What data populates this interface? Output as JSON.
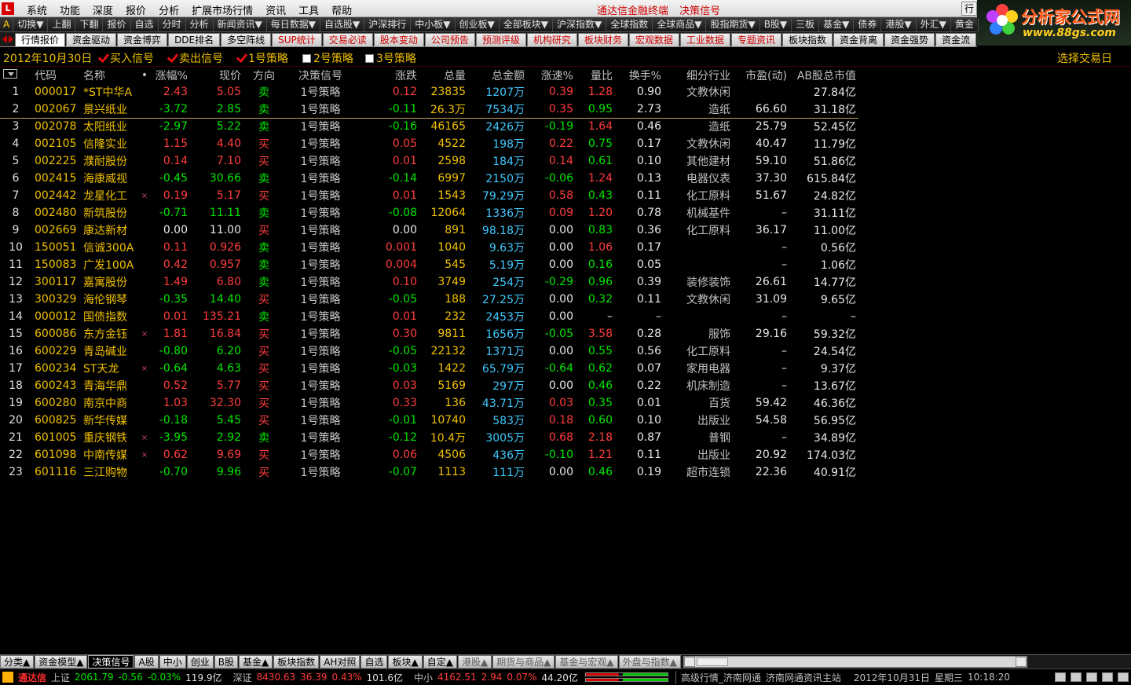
{
  "titlebar": {
    "app_icon": "tdx-logo-icon",
    "menus": [
      "系统",
      "功能",
      "深度",
      "报价",
      "分析",
      "扩展市场行情",
      "资讯",
      "工具",
      "帮助"
    ],
    "center_text": [
      "通达信金融终端",
      "决策信号"
    ],
    "right_button": "行"
  },
  "brand": {
    "title": "分析家公式网",
    "url": "www.88gs.com"
  },
  "toolbar": {
    "items": [
      "A",
      "切换▼",
      "上翻",
      "下翻",
      "报价",
      "自选",
      "分时",
      "分析",
      "新闻资讯▼",
      "每日数据▼",
      "自选股▼",
      "沪深排行",
      "中小板▼",
      "创业板▼",
      "全部板块▼",
      "沪深指数▼",
      "全球指数",
      "全球商品▼",
      "股指期货▼",
      "B股▼",
      "三板",
      "基金▼",
      "债券",
      "港股▼",
      "外汇▼",
      "黄金"
    ]
  },
  "tabs": [
    {
      "label": "行情报价",
      "red": false,
      "active": true
    },
    {
      "label": "资金驱动",
      "red": false,
      "active": false
    },
    {
      "label": "资金博弈",
      "red": false,
      "active": false
    },
    {
      "label": "DDE排名",
      "red": false,
      "active": false
    },
    {
      "label": "多空阵线",
      "red": false,
      "active": false
    },
    {
      "label": "SUP统计",
      "red": true,
      "active": false
    },
    {
      "label": "交易必读",
      "red": true,
      "active": false
    },
    {
      "label": "股本变动",
      "red": true,
      "active": false
    },
    {
      "label": "公司预告",
      "red": true,
      "active": false
    },
    {
      "label": "预测评级",
      "red": true,
      "active": false
    },
    {
      "label": "机构研究",
      "red": true,
      "active": false
    },
    {
      "label": "板块财务",
      "red": true,
      "active": false
    },
    {
      "label": "宏观数据",
      "red": true,
      "active": false
    },
    {
      "label": "工业数据",
      "red": true,
      "active": false
    },
    {
      "label": "专题资讯",
      "red": true,
      "active": false
    },
    {
      "label": "板块指数",
      "red": false,
      "active": false
    },
    {
      "label": "资金背离",
      "red": false,
      "active": false
    },
    {
      "label": "资金强势",
      "red": false,
      "active": false
    },
    {
      "label": "资金流",
      "red": false,
      "active": false
    }
  ],
  "inforow": {
    "date": "2012年10月30日",
    "options": [
      {
        "label": "买入信号",
        "checked": true
      },
      {
        "label": "卖出信号",
        "checked": true
      },
      {
        "label": "1号策略",
        "checked": true
      },
      {
        "label": "2号策略",
        "checked": false
      },
      {
        "label": "3号策略",
        "checked": false
      }
    ],
    "select_date": "选择交易日"
  },
  "table": {
    "headers": [
      "代码",
      "名称",
      "•",
      "涨幅%",
      "现价",
      "方向",
      "决策信号",
      "涨跌",
      "总量",
      "总金额",
      "涨速%",
      "量比",
      "换手%",
      "细分行业",
      "市盈(动)",
      "AB股总市值"
    ],
    "rows": [
      {
        "no": "1",
        "code": "000017",
        "name": "*ST中华A",
        "mark": "",
        "chg": "2.43",
        "price": "5.05",
        "dir": "卖",
        "signal": "1号策略",
        "diff": "0.12",
        "vol": "23835",
        "amt": "1207万",
        "speed": "0.39",
        "qr": "1.28",
        "turn": "0.90",
        "ind": "文教休闲",
        "pe": "",
        "mcap": "27.84亿"
      },
      {
        "no": "2",
        "code": "002067",
        "name": "景兴纸业",
        "mark": "",
        "chg": "-3.72",
        "price": "2.85",
        "dir": "卖",
        "signal": "1号策略",
        "diff": "-0.11",
        "vol": "26.3万",
        "amt": "7534万",
        "speed": "0.35",
        "qr": "0.95",
        "turn": "2.73",
        "ind": "造纸",
        "pe": "66.60",
        "mcap": "31.18亿"
      },
      {
        "no": "3",
        "code": "002078",
        "name": "太阳纸业",
        "mark": "",
        "chg": "-2.97",
        "price": "5.22",
        "dir": "卖",
        "signal": "1号策略",
        "diff": "-0.16",
        "vol": "46165",
        "amt": "2426万",
        "speed": "-0.19",
        "qr": "1.64",
        "turn": "0.46",
        "ind": "造纸",
        "pe": "25.79",
        "mcap": "52.45亿"
      },
      {
        "no": "4",
        "code": "002105",
        "name": "信隆实业",
        "mark": "",
        "chg": "1.15",
        "price": "4.40",
        "dir": "买",
        "signal": "1号策略",
        "diff": "0.05",
        "vol": "4522",
        "amt": "198万",
        "speed": "0.22",
        "qr": "0.75",
        "turn": "0.17",
        "ind": "文教休闲",
        "pe": "40.47",
        "mcap": "11.79亿"
      },
      {
        "no": "5",
        "code": "002225",
        "name": "濮耐股份",
        "mark": "",
        "chg": "0.14",
        "price": "7.10",
        "dir": "买",
        "signal": "1号策略",
        "diff": "0.01",
        "vol": "2598",
        "amt": "184万",
        "speed": "0.14",
        "qr": "0.61",
        "turn": "0.10",
        "ind": "其他建材",
        "pe": "59.10",
        "mcap": "51.86亿"
      },
      {
        "no": "6",
        "code": "002415",
        "name": "海康威视",
        "mark": "",
        "chg": "-0.45",
        "price": "30.66",
        "dir": "卖",
        "signal": "1号策略",
        "diff": "-0.14",
        "vol": "6997",
        "amt": "2150万",
        "speed": "-0.06",
        "qr": "1.24",
        "turn": "0.13",
        "ind": "电器仪表",
        "pe": "37.30",
        "mcap": "615.84亿"
      },
      {
        "no": "7",
        "code": "002442",
        "name": "龙星化工",
        "mark": "×",
        "chg": "0.19",
        "price": "5.17",
        "dir": "买",
        "signal": "1号策略",
        "diff": "0.01",
        "vol": "1543",
        "amt": "79.29万",
        "speed": "0.58",
        "qr": "0.43",
        "turn": "0.11",
        "ind": "化工原料",
        "pe": "51.67",
        "mcap": "24.82亿"
      },
      {
        "no": "8",
        "code": "002480",
        "name": "新筑股份",
        "mark": "",
        "chg": "-0.71",
        "price": "11.11",
        "dir": "卖",
        "signal": "1号策略",
        "diff": "-0.08",
        "vol": "12064",
        "amt": "1336万",
        "speed": "0.09",
        "qr": "1.20",
        "turn": "0.78",
        "ind": "机械基件",
        "pe": "–",
        "mcap": "31.11亿"
      },
      {
        "no": "9",
        "code": "002669",
        "name": "康达新材",
        "mark": "",
        "chg": "0.00",
        "price": "11.00",
        "dir": "买",
        "signal": "1号策略",
        "diff": "0.00",
        "vol": "891",
        "amt": "98.18万",
        "speed": "0.00",
        "qr": "0.83",
        "turn": "0.36",
        "ind": "化工原料",
        "pe": "36.17",
        "mcap": "11.00亿"
      },
      {
        "no": "10",
        "code": "150051",
        "name": "信诚300A",
        "mark": "",
        "chg": "0.11",
        "price": "0.926",
        "dir": "卖",
        "signal": "1号策略",
        "diff": "0.001",
        "vol": "1040",
        "amt": "9.63万",
        "speed": "0.00",
        "qr": "1.06",
        "turn": "0.17",
        "ind": "",
        "pe": "–",
        "mcap": "0.56亿"
      },
      {
        "no": "11",
        "code": "150083",
        "name": "广发100A",
        "mark": "",
        "chg": "0.42",
        "price": "0.957",
        "dir": "卖",
        "signal": "1号策略",
        "diff": "0.004",
        "vol": "545",
        "amt": "5.19万",
        "speed": "0.00",
        "qr": "0.16",
        "turn": "0.05",
        "ind": "",
        "pe": "–",
        "mcap": "1.06亿"
      },
      {
        "no": "12",
        "code": "300117",
        "name": "嘉寓股份",
        "mark": "",
        "chg": "1.49",
        "price": "6.80",
        "dir": "卖",
        "signal": "1号策略",
        "diff": "0.10",
        "vol": "3749",
        "amt": "254万",
        "speed": "-0.29",
        "qr": "0.96",
        "turn": "0.39",
        "ind": "装修装饰",
        "pe": "26.61",
        "mcap": "14.77亿"
      },
      {
        "no": "13",
        "code": "300329",
        "name": "海伦钢琴",
        "mark": "",
        "chg": "-0.35",
        "price": "14.40",
        "dir": "买",
        "signal": "1号策略",
        "diff": "-0.05",
        "vol": "188",
        "amt": "27.25万",
        "speed": "0.00",
        "qr": "0.32",
        "turn": "0.11",
        "ind": "文教休闲",
        "pe": "31.09",
        "mcap": "9.65亿"
      },
      {
        "no": "14",
        "code": "000012",
        "name": "国债指数",
        "mark": "",
        "chg": "0.01",
        "price": "135.21",
        "dir": "卖",
        "signal": "1号策略",
        "diff": "0.01",
        "vol": "232",
        "amt": "2453万",
        "speed": "0.00",
        "qr": "–",
        "turn": "–",
        "ind": "",
        "pe": "–",
        "mcap": "–"
      },
      {
        "no": "15",
        "code": "600086",
        "name": "东方金钰",
        "mark": "×",
        "chg": "1.81",
        "price": "16.84",
        "dir": "买",
        "signal": "1号策略",
        "diff": "0.30",
        "vol": "9811",
        "amt": "1656万",
        "speed": "-0.05",
        "qr": "3.58",
        "turn": "0.28",
        "ind": "服饰",
        "pe": "29.16",
        "mcap": "59.32亿"
      },
      {
        "no": "16",
        "code": "600229",
        "name": "青岛碱业",
        "mark": "",
        "chg": "-0.80",
        "price": "6.20",
        "dir": "买",
        "signal": "1号策略",
        "diff": "-0.05",
        "vol": "22132",
        "amt": "1371万",
        "speed": "0.00",
        "qr": "0.55",
        "turn": "0.56",
        "ind": "化工原料",
        "pe": "–",
        "mcap": "24.54亿"
      },
      {
        "no": "17",
        "code": "600234",
        "name": "ST天龙",
        "mark": "×",
        "chg": "-0.64",
        "price": "4.63",
        "dir": "买",
        "signal": "1号策略",
        "diff": "-0.03",
        "vol": "1422",
        "amt": "65.79万",
        "speed": "-0.64",
        "qr": "0.62",
        "turn": "0.07",
        "ind": "家用电器",
        "pe": "–",
        "mcap": "9.37亿"
      },
      {
        "no": "18",
        "code": "600243",
        "name": "青海华鼎",
        "mark": "",
        "chg": "0.52",
        "price": "5.77",
        "dir": "买",
        "signal": "1号策略",
        "diff": "0.03",
        "vol": "5169",
        "amt": "297万",
        "speed": "0.00",
        "qr": "0.46",
        "turn": "0.22",
        "ind": "机床制造",
        "pe": "–",
        "mcap": "13.67亿"
      },
      {
        "no": "19",
        "code": "600280",
        "name": "南京中商",
        "mark": "",
        "chg": "1.03",
        "price": "32.30",
        "dir": "买",
        "signal": "1号策略",
        "diff": "0.33",
        "vol": "136",
        "amt": "43.71万",
        "speed": "0.03",
        "qr": "0.35",
        "turn": "0.01",
        "ind": "百货",
        "pe": "59.42",
        "mcap": "46.36亿"
      },
      {
        "no": "20",
        "code": "600825",
        "name": "新华传媒",
        "mark": "",
        "chg": "-0.18",
        "price": "5.45",
        "dir": "买",
        "signal": "1号策略",
        "diff": "-0.01",
        "vol": "10740",
        "amt": "583万",
        "speed": "0.18",
        "qr": "0.60",
        "turn": "0.10",
        "ind": "出版业",
        "pe": "54.58",
        "mcap": "56.95亿"
      },
      {
        "no": "21",
        "code": "601005",
        "name": "重庆钢铁",
        "mark": "×",
        "chg": "-3.95",
        "price": "2.92",
        "dir": "卖",
        "signal": "1号策略",
        "diff": "-0.12",
        "vol": "10.4万",
        "amt": "3005万",
        "speed": "0.68",
        "qr": "2.18",
        "turn": "0.87",
        "ind": "普钢",
        "pe": "–",
        "mcap": "34.89亿"
      },
      {
        "no": "22",
        "code": "601098",
        "name": "中南传媒",
        "mark": "×",
        "chg": "0.62",
        "price": "9.69",
        "dir": "买",
        "signal": "1号策略",
        "diff": "0.06",
        "vol": "4506",
        "amt": "436万",
        "speed": "-0.10",
        "qr": "1.21",
        "turn": "0.11",
        "ind": "出版业",
        "pe": "20.92",
        "mcap": "174.03亿"
      },
      {
        "no": "23",
        "code": "601116",
        "name": "三江购物",
        "mark": "",
        "chg": "-0.70",
        "price": "9.96",
        "dir": "买",
        "signal": "1号策略",
        "diff": "-0.07",
        "vol": "1113",
        "amt": "111万",
        "speed": "0.00",
        "qr": "0.46",
        "turn": "0.19",
        "ind": "超市连锁",
        "pe": "22.36",
        "mcap": "40.91亿"
      }
    ]
  },
  "category_tabs": [
    {
      "label": "分类▲",
      "active": false,
      "dim": false
    },
    {
      "label": "资金模型▲",
      "active": false,
      "dim": false
    },
    {
      "label": "决策信号",
      "active": true,
      "dim": false
    },
    {
      "label": "A股",
      "active": false,
      "dim": false
    },
    {
      "label": "中小",
      "active": false,
      "dim": false
    },
    {
      "label": "创业",
      "active": false,
      "dim": false
    },
    {
      "label": "B股",
      "active": false,
      "dim": false
    },
    {
      "label": "基金▲",
      "active": false,
      "dim": false
    },
    {
      "label": "板块指数",
      "active": false,
      "dim": false
    },
    {
      "label": "AH对照",
      "active": false,
      "dim": false
    },
    {
      "label": "自选",
      "active": false,
      "dim": false
    },
    {
      "label": "板块▲",
      "active": false,
      "dim": false
    },
    {
      "label": "自定▲",
      "active": false,
      "dim": false
    },
    {
      "label": "港股▲",
      "active": false,
      "dim": true
    },
    {
      "label": "期货与商品▲",
      "active": false,
      "dim": true
    },
    {
      "label": "基金与宏观▲",
      "active": false,
      "dim": true
    },
    {
      "label": "外盘与指数▲",
      "active": false,
      "dim": true
    }
  ],
  "statusbar": {
    "brand": "通达信",
    "sh_label": "上证",
    "sh_index": "2061.79",
    "sh_chg": "-0.56",
    "sh_pct": "-0.03%",
    "sh_amt": "119.9亿",
    "sz_label": "深证",
    "sz_index": "8430.63",
    "sz_chg": "36.39",
    "sz_pct": "0.43%",
    "sz_amt": "101.6亿",
    "zx_label": "中小",
    "zx_index": "4162.51",
    "zx_chg": "2.94",
    "zx_pct": "0.07%",
    "zx_amt": "44.20亿",
    "server": "高级行情_济南网通",
    "news_server": "济南网通资讯主站",
    "date": "2012年10月31日",
    "weekday": "星期三",
    "time": "10:18:20"
  }
}
